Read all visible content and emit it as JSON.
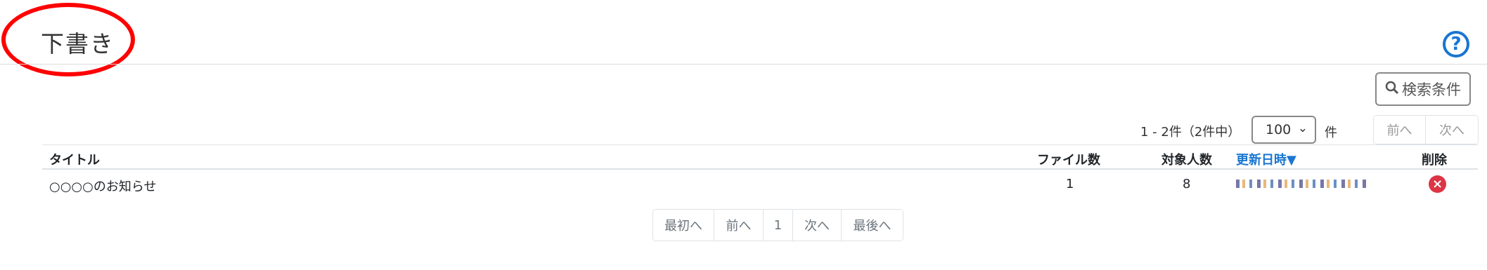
{
  "page": {
    "title": "下書き"
  },
  "toolbar": {
    "search_conditions_label": "検索条件"
  },
  "results": {
    "count_text": "1 - 2件（2件中）",
    "page_size": "100",
    "unit": "件"
  },
  "top_pagination": {
    "prev": "前へ",
    "next": "次へ"
  },
  "table": {
    "headers": {
      "title": "タイトル",
      "files": "ファイル数",
      "recipients": "対象人数",
      "updated": "更新日時▼",
      "delete": "削除"
    },
    "rows": [
      {
        "title": "○○○○のお知らせ",
        "files": "1",
        "recipients": "8"
      }
    ]
  },
  "bottom_pagination": {
    "first": "最初へ",
    "prev": "前へ",
    "page": "1",
    "next": "次へ",
    "last": "最後へ"
  },
  "colors": {
    "accent": "#1976d2",
    "delete": "#dc3545",
    "annotation": "#ff0000"
  }
}
